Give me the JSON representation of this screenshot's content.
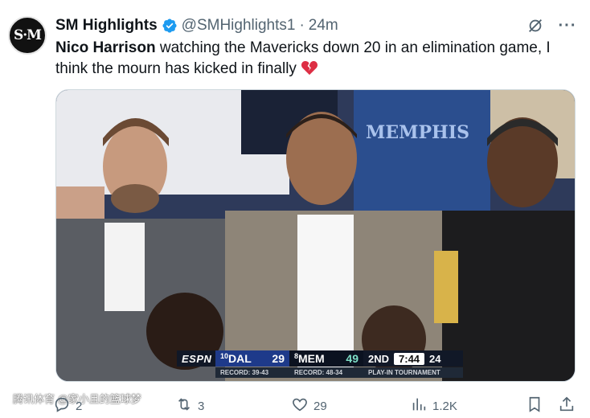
{
  "tweet": {
    "avatar_text": "S·M",
    "display_name": "SM Highlights",
    "handle": "@SMHighlights1",
    "dot": "·",
    "time": "24m",
    "text_mention": "Nico Harrison",
    "text_body": " watching the Mavericks down 20 in an elimination game, I think the mourn has kicked in finally ",
    "emoji_icon": "broken-heart"
  },
  "scorebug": {
    "network": "ESPN",
    "team1_seed": "10",
    "team1": "DAL",
    "team1_score": "29",
    "team2_seed": "8",
    "team2": "MEM",
    "team2_score": "49",
    "period": "2ND",
    "clock": "7:44",
    "shot_clock": "24",
    "team1_record": "RECORD: 39-43",
    "team2_record": "RECORD: 48-34",
    "event": "PLAY-IN TOURNAMENT"
  },
  "watermark": "腾讯体育 @家小且的篮球梦",
  "actions": {
    "replies": "2",
    "reposts": "3",
    "likes": "29",
    "views": "1.2K"
  },
  "colors": {
    "verified": "#1d9bf0",
    "broken_heart": "#dd2e44",
    "muted_text": "#536471"
  }
}
